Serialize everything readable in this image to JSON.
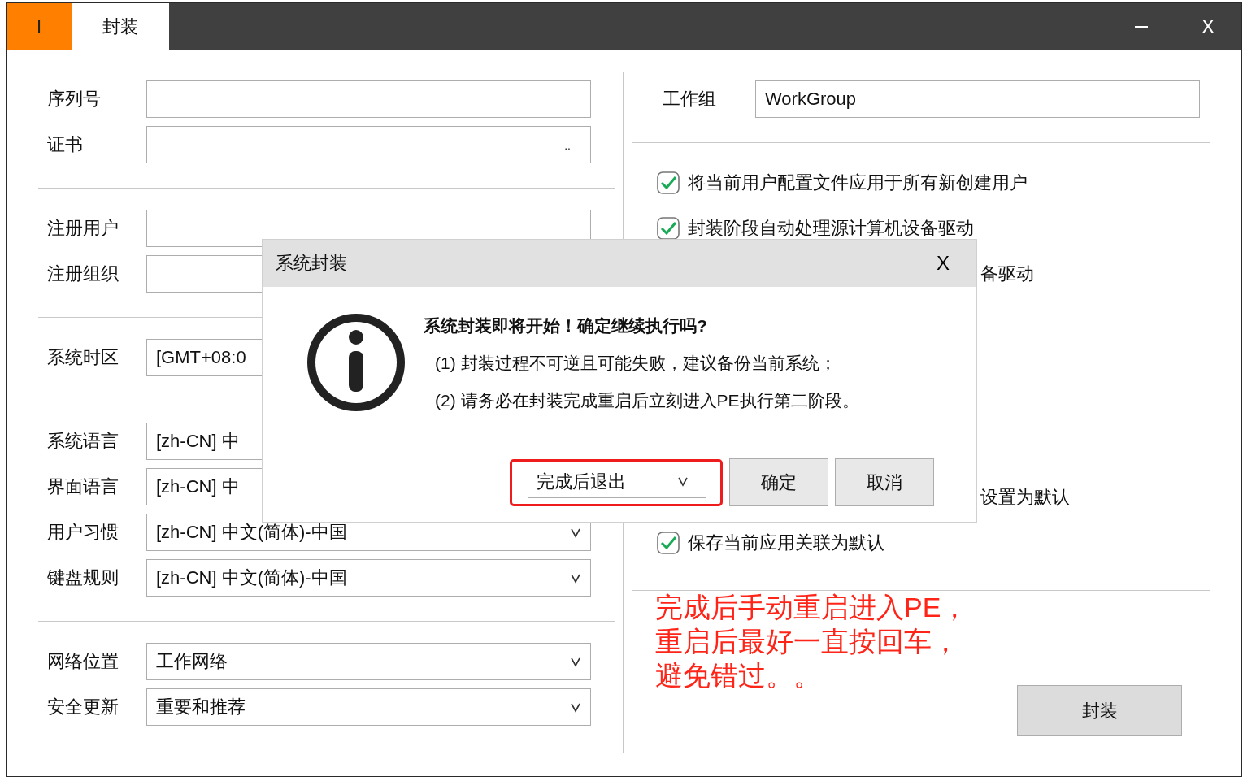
{
  "window": {
    "tabs": [
      {
        "label": "I",
        "selected": false
      },
      {
        "label": "封装",
        "selected": true
      }
    ],
    "close": "X"
  },
  "left_groups": [
    {
      "rows": [
        {
          "label": "序列号",
          "kind": "text"
        },
        {
          "label": "证书",
          "kind": "file",
          "browse": ".."
        }
      ]
    },
    {
      "rows": [
        {
          "label": "注册用户",
          "kind": "text"
        },
        {
          "label": "注册组织",
          "kind": "text"
        }
      ]
    },
    {
      "rows": [
        {
          "label": "系统时区",
          "kind": "text",
          "value": "[GMT+08:0"
        }
      ]
    },
    {
      "rows": [
        {
          "label": "系统语言",
          "kind": "covered",
          "value": "[zh-CN] 中"
        },
        {
          "label": "界面语言",
          "kind": "covered",
          "value": "[zh-CN] 中"
        },
        {
          "label": "用户习惯",
          "kind": "dropdown",
          "value": "[zh-CN] 中文(简体)-中国"
        },
        {
          "label": "键盘规则",
          "kind": "dropdown",
          "value": "[zh-CN] 中文(简体)-中国"
        }
      ]
    },
    {
      "rows": [
        {
          "label": "网络位置",
          "kind": "dropdown",
          "value": "工作网络"
        },
        {
          "label": "安全更新",
          "kind": "dropdown",
          "value": "重要和推荐"
        }
      ]
    }
  ],
  "workgroup": {
    "label": "工作组",
    "value": "WorkGroup"
  },
  "option_groups": [
    {
      "options": [
        {
          "kind": "checkbox",
          "label": "将当前用户配置文件应用于所有新创建用户",
          "checked": true
        },
        {
          "kind": "checkbox",
          "label": "封装阶段自动处理源计算机设备驱动",
          "checked": true
        },
        {
          "kind": "tail",
          "label": "备驱动"
        }
      ]
    },
    {
      "options": [
        {
          "kind": "tail",
          "label": "设置为默认"
        },
        {
          "kind": "checkbox",
          "label": "保存当前应用关联为默认",
          "checked": true
        }
      ]
    }
  ],
  "seal_button": "封装",
  "dialog": {
    "title": "系统封装",
    "close": "X",
    "heading": "系统封装即将开始！确定继续执行吗?",
    "items": [
      "(1) 封装过程不可逆且可能失败，建议备份当前系统；",
      "(2) 请务必在封装完成重启后立刻进入PE执行第二阶段。"
    ],
    "after_action": "完成后退出",
    "buttons": [
      "确定",
      "取消"
    ]
  },
  "annotation": {
    "lines": [
      "完成后手动重启进入PE，",
      "重启后最好一直按回车，",
      "避免错过。。"
    ]
  }
}
